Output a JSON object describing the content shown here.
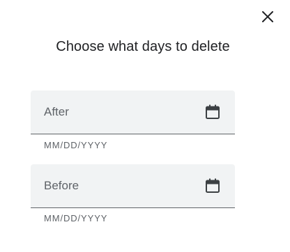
{
  "dialog": {
    "title": "Choose what days to delete",
    "close_icon": "close-icon"
  },
  "fields": {
    "after": {
      "label": "After",
      "helper": "MM/DD/YYYY",
      "icon": "calendar-icon"
    },
    "before": {
      "label": "Before",
      "helper": "MM/DD/YYYY",
      "icon": "calendar-icon"
    }
  },
  "colors": {
    "field_background": "#f1f3f4",
    "field_underline": "#5f6368",
    "text_primary": "#202124",
    "text_secondary": "#5f6368",
    "icon": "#3c4043"
  }
}
